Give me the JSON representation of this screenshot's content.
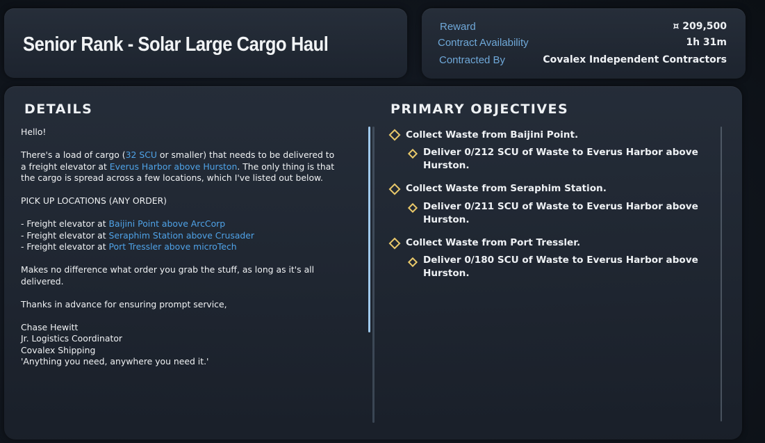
{
  "contract": {
    "title": "Senior Rank - Solar Large Cargo Haul"
  },
  "info": {
    "reward_label": "Reward",
    "reward_value": "¤ 209,500",
    "availability_label": "Contract Availability",
    "availability_value": "1h 31m",
    "contracted_by_label": "Contracted By",
    "contracted_by_value": "Covalex Independent Contractors"
  },
  "details": {
    "heading": "DETAILS",
    "greeting": "Hello!",
    "p1_a": "There's a load of cargo (",
    "p1_link1": "32 SCU",
    "p1_b": " or smaller) that needs to be delivered to a freight elevator at ",
    "p1_link2": "Everus Harbor above Hurston",
    "p1_c": ". The only thing is that the cargo is spread across a few locations, which I've listed out below.",
    "pickup_heading": "PICK UP LOCATIONS (ANY ORDER)",
    "locations": [
      {
        "prefix": "- Freight elevator at ",
        "link": "Baijini Point above ArcCorp"
      },
      {
        "prefix": "- Freight elevator at ",
        "link": "Seraphim Station above Crusader"
      },
      {
        "prefix": "- Freight elevator at ",
        "link": "Port Tressler above microTech"
      }
    ],
    "p3": "Makes no difference what order you grab the stuff, as long as it's all delivered.",
    "p4": "Thanks in advance for ensuring prompt service,",
    "sig_name": "Chase Hewitt",
    "sig_title": "Jr. Logistics Coordinator",
    "sig_company": "Covalex Shipping",
    "sig_motto": "'Anything you need, anywhere you need it.'"
  },
  "objectives": {
    "heading": "PRIMARY OBJECTIVES",
    "items": [
      {
        "main": "Collect Waste from Baijini Point.",
        "sub_line1": "Deliver 0/212 SCU of Waste to Everus Harbor above",
        "sub_line2": "Hurston."
      },
      {
        "main": "Collect Waste from Seraphim Station.",
        "sub_line1": "Deliver 0/211 SCU of Waste to Everus Harbor above",
        "sub_line2": "Hurston."
      },
      {
        "main": "Collect Waste from Port Tressler.",
        "sub_line1": "Deliver 0/180 SCU of Waste to Everus Harbor above",
        "sub_line2": "Hurston."
      }
    ]
  },
  "colors": {
    "accent_link": "#4fa3e8",
    "label_blue": "#6fa8d8",
    "objective_marker": "#e9c86a"
  }
}
